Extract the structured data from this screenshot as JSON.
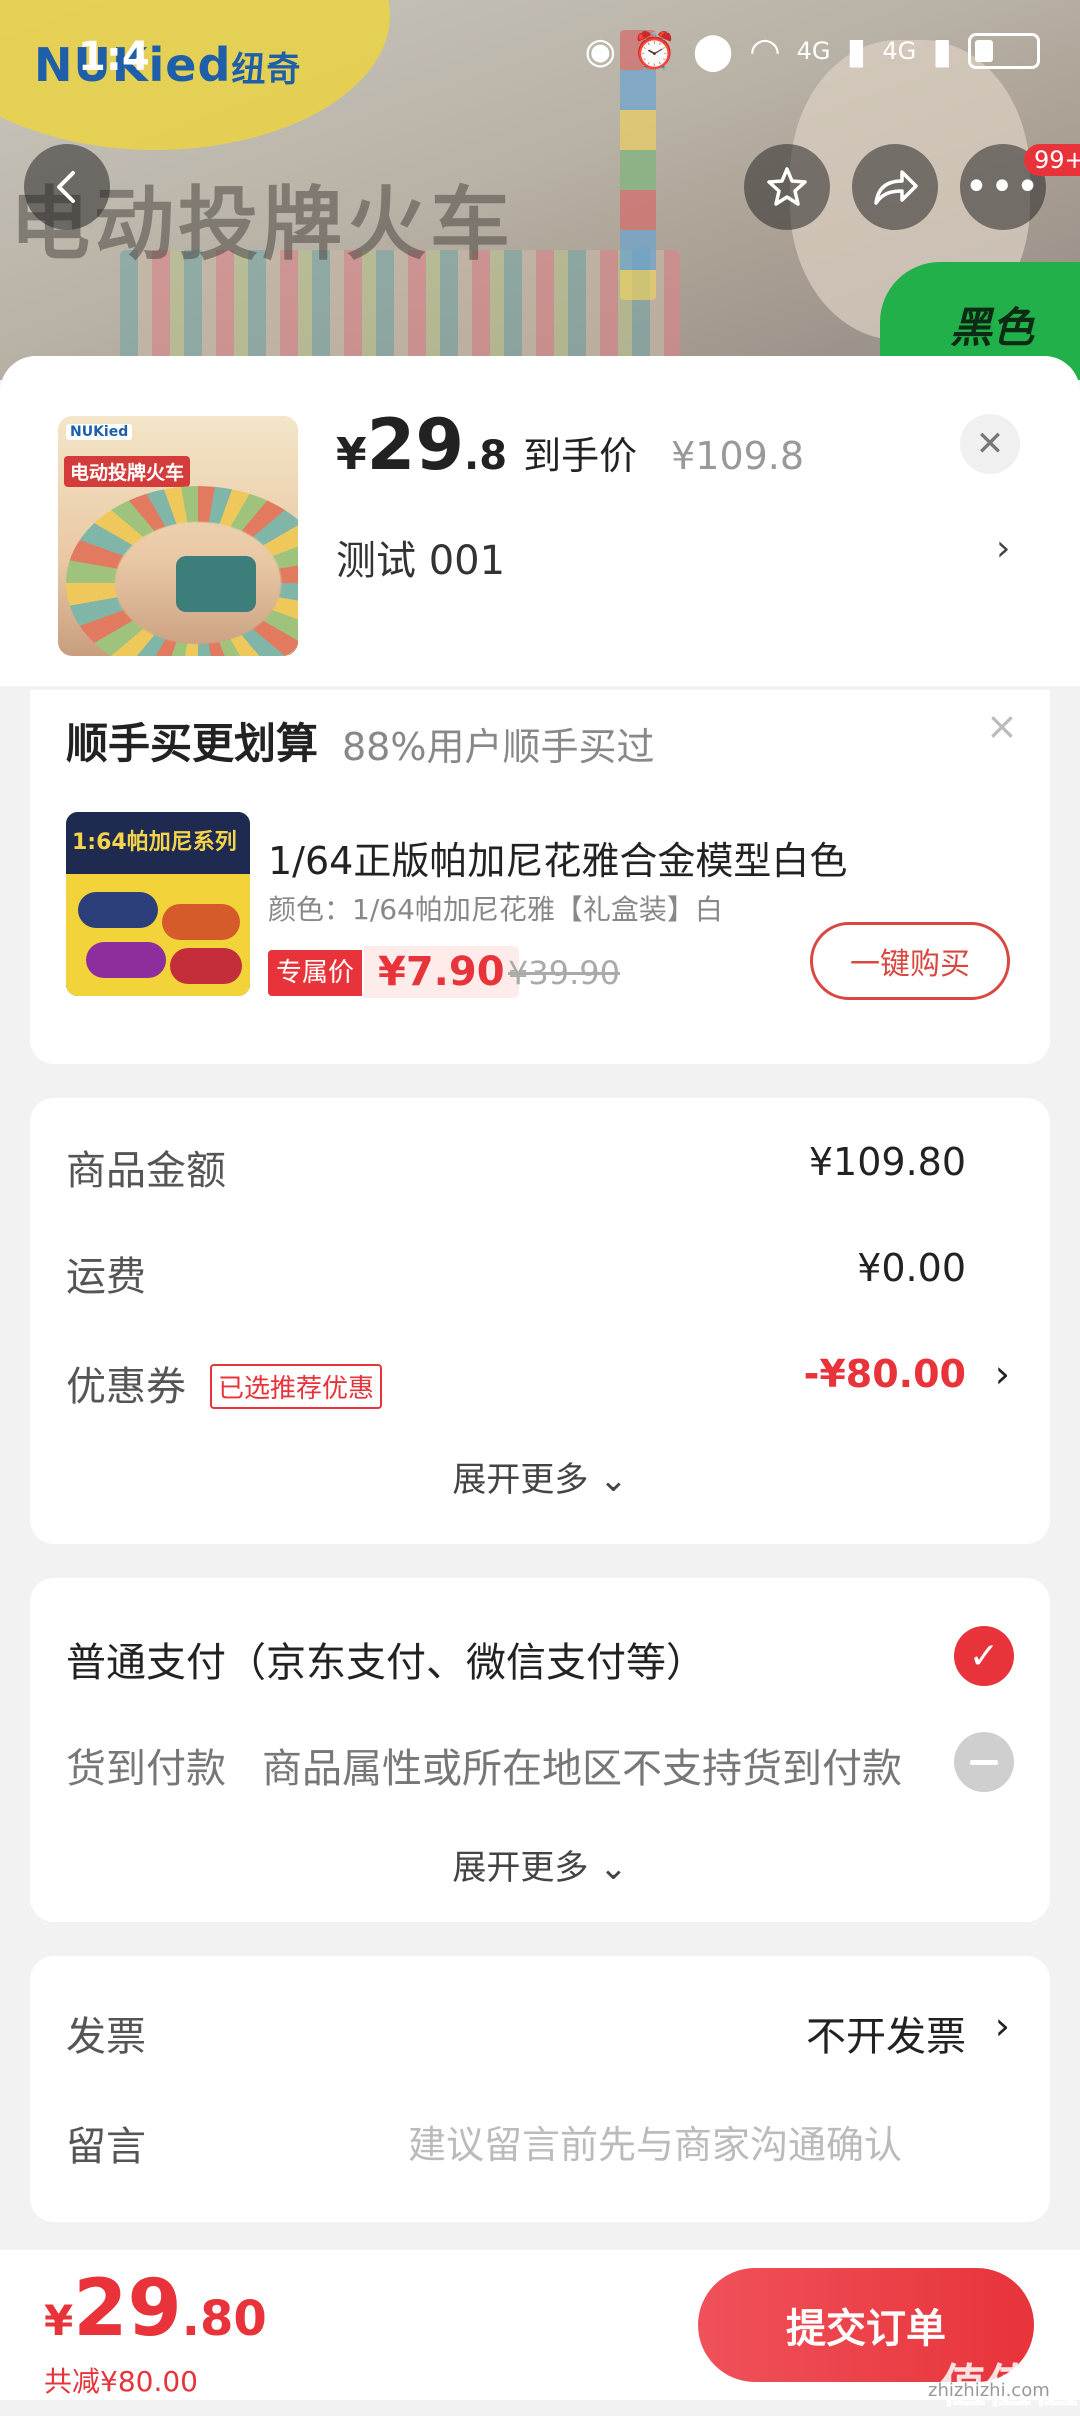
{
  "status": {
    "time": "1:4",
    "network": "4G",
    "network2": "4G"
  },
  "banner": {
    "brand": "NUKied",
    "brand_cn": "纽奇",
    "headline": "电动投牌火车",
    "color_tag": "黑色",
    "menu_badge": "99+"
  },
  "icons": {
    "back": "back-arrow-icon",
    "favorite": "star-icon",
    "share": "share-icon",
    "more": "more-icon",
    "close": "close-icon"
  },
  "product": {
    "thumb_brand": "NUKied",
    "thumb_title": "电动投牌火车",
    "price_currency": "¥",
    "price_int": "29",
    "price_dec": ".8",
    "price_label": "到手价",
    "original_price": "¥109.8",
    "spec": "测试  001",
    "spec_arrow": "›"
  },
  "upsell": {
    "title": "顺手买更划算",
    "subtitle": "88%用户顺手买过",
    "close": "×",
    "image_text": "1:64帕加尼系列",
    "item_name": "1/64正版帕加尼花雅合金模型白色",
    "item_spec": "颜色：1/64帕加尼花雅【礼盒装】白",
    "tag": "专属价",
    "price": "¥7.90",
    "original_price": "¥39.90",
    "buy_label": "一键购买"
  },
  "summary": {
    "goods_label": "商品金额",
    "goods_value": "¥109.80",
    "shipping_label": "运费",
    "shipping_value": "¥0.00",
    "coupon_label": "优惠券",
    "coupon_tag": "已选推荐优惠",
    "coupon_value": "-¥80.00",
    "arrow": "›",
    "expand": "展开更多 ⌄"
  },
  "payment": {
    "normal": "普通支付（京东支付、微信支付等）",
    "cod_label": "货到付款",
    "cod_note": "商品属性或所在地区不支持货到付款",
    "expand": "展开更多 ⌄"
  },
  "extra": {
    "invoice_label": "发票",
    "invoice_value": "不开发票",
    "arrow": "›",
    "note_label": "留言",
    "note_placeholder": "建议留言前先与商家沟通确认"
  },
  "footer": {
    "currency": "¥",
    "total_int": "29",
    "total_dec": ".80",
    "saved": "共减¥80.00",
    "submit": "提交订单"
  },
  "watermark": {
    "mark": "值值值",
    "url": "zhizhizhi.com"
  },
  "colors": {
    "accent": "#e8333a",
    "banner_green": "#22b04a"
  }
}
